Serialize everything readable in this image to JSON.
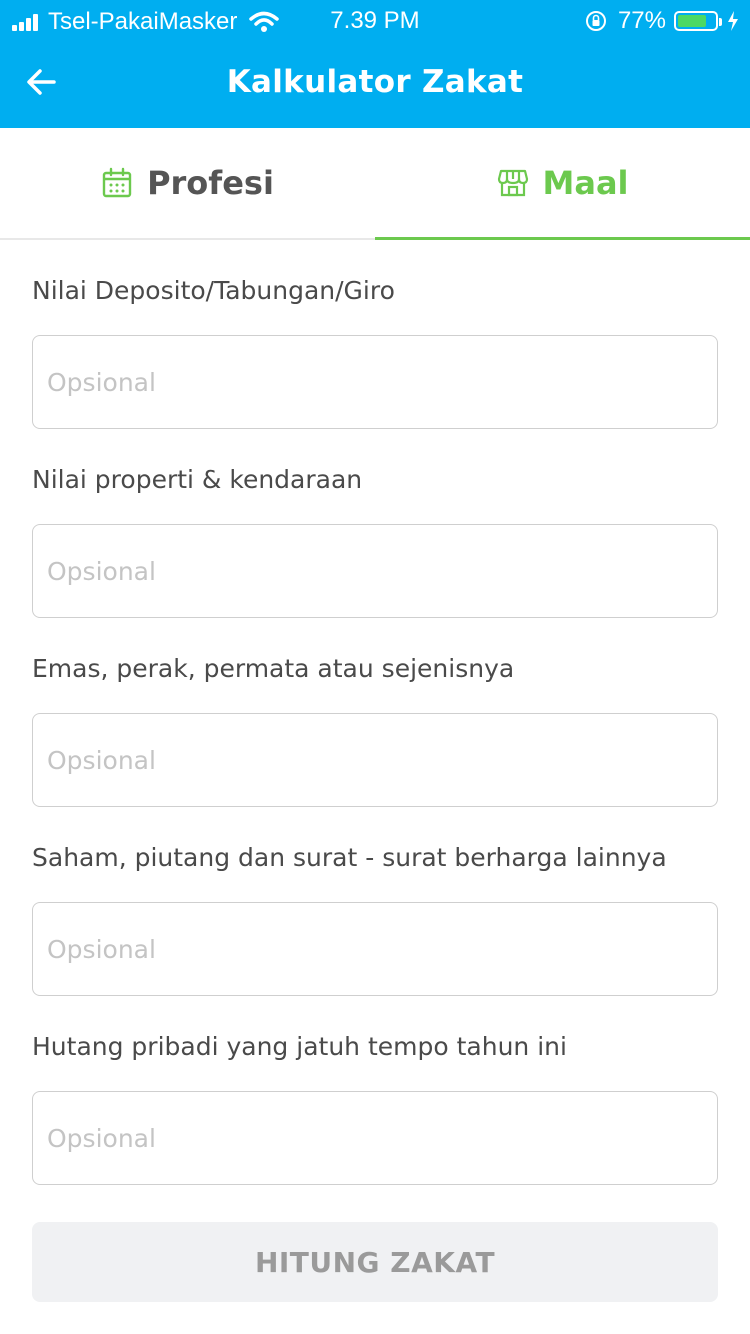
{
  "status_bar": {
    "carrier": "Tsel-PakaiMasker",
    "time": "7.39 PM",
    "battery_text": "77%",
    "battery_level": 0.77
  },
  "header": {
    "title": "Kalkulator Zakat",
    "back_icon": "arrow-left-icon"
  },
  "tabs": [
    {
      "label": "Profesi",
      "icon": "calendar-icon",
      "active": false
    },
    {
      "label": "Maal",
      "icon": "store-icon",
      "active": true
    }
  ],
  "form": {
    "fields": [
      {
        "label": "Nilai Deposito/Tabungan/Giro",
        "placeholder": "Opsional",
        "value": ""
      },
      {
        "label": "Nilai properti & kendaraan",
        "placeholder": "Opsional",
        "value": ""
      },
      {
        "label": "Emas, perak, permata atau sejenisnya",
        "placeholder": "Opsional",
        "value": ""
      },
      {
        "label": "Saham, piutang dan surat - surat berharga lainnya",
        "placeholder": "Opsional",
        "value": ""
      },
      {
        "label": "Hutang pribadi yang jatuh tempo tahun ini",
        "placeholder": "Opsional",
        "value": ""
      }
    ],
    "submit_label": "HITUNG ZAKAT"
  },
  "colors": {
    "primary": "#00aef0",
    "accent": "#6cc94e",
    "button_disabled_bg": "#f0f1f3",
    "button_disabled_text": "#9a9a9a"
  }
}
